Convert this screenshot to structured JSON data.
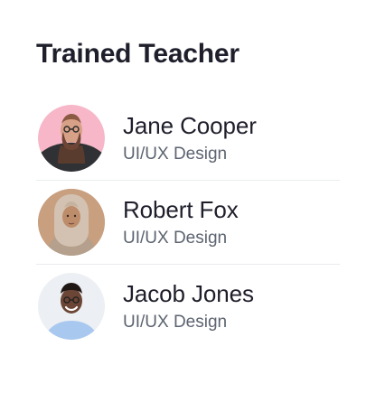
{
  "header": {
    "title": "Trained Teacher"
  },
  "teachers": [
    {
      "name": "Jane Cooper",
      "role": "UI/UX Design",
      "avatar_icon": "avatar-bearded-man-icon"
    },
    {
      "name": "Robert Fox",
      "role": "UI/UX Design",
      "avatar_icon": "avatar-hijab-woman-icon"
    },
    {
      "name": "Jacob Jones",
      "role": "UI/UX Design",
      "avatar_icon": "avatar-smiling-man-icon"
    }
  ],
  "colors": {
    "text_primary": "#1e1f2b",
    "text_secondary": "#5c6370",
    "divider": "#e9ebef",
    "background": "#ffffff"
  }
}
